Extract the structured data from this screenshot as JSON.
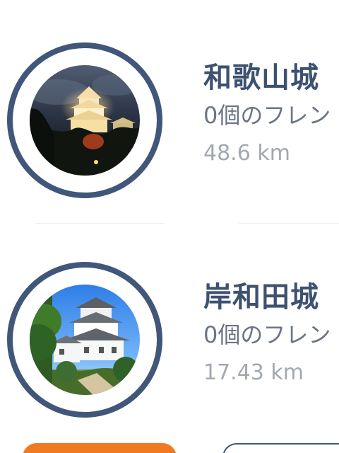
{
  "castles": [
    {
      "name": "和歌山城",
      "friends_text": "0個のフレン",
      "distance": "48.6 km",
      "photo_icon": "night-castle-photo"
    },
    {
      "name": "岸和田城",
      "friends_text": "0個のフレン",
      "distance": "17.43 km",
      "photo_icon": "day-castle-photo"
    }
  ],
  "colors": {
    "accent_navy": "#40577a",
    "title_navy": "#3d5170",
    "secondary_gray": "#6b7585",
    "muted_gray": "#a2a8b1",
    "action_orange": "#f07a22"
  }
}
